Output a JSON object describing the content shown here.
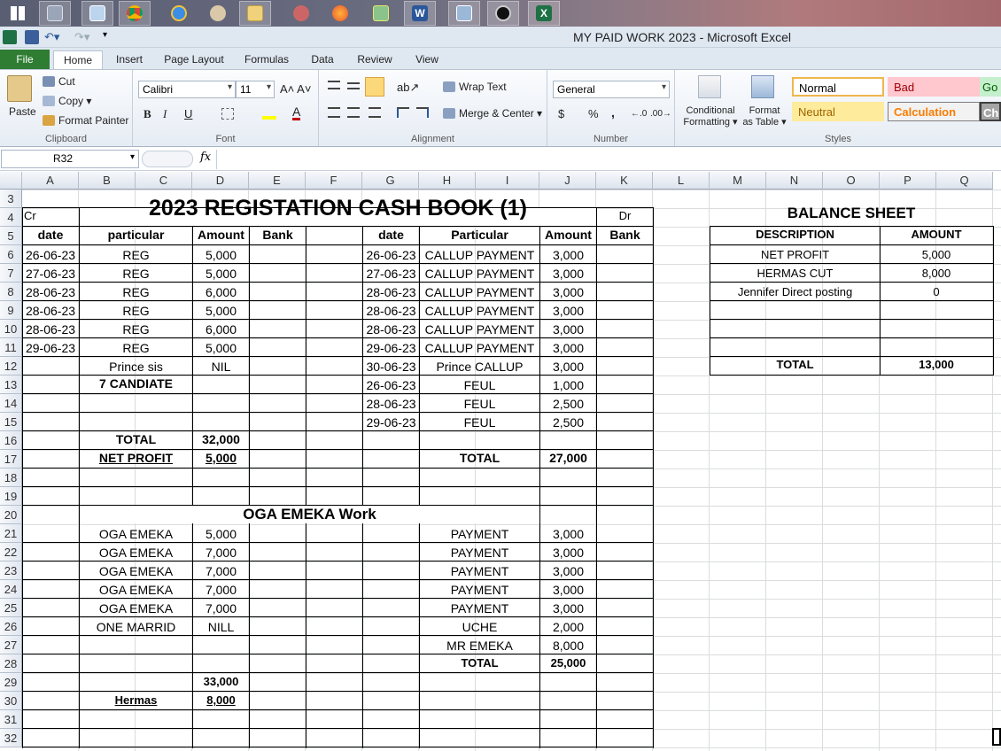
{
  "window": {
    "title": "MY PAID WORK 2023  -  Microsoft Excel"
  },
  "colors": {
    "accent": "#2e7d32",
    "ribbon_bg": "#e6ecf4",
    "style_bad": "#ffc7ce",
    "style_neutral": "#ffeb9c",
    "style_good": "#c6efce"
  },
  "taskbar": {
    "icons": [
      "start-icon",
      "calculator-icon",
      "notepad-icon",
      "chrome-icon",
      "internet-explorer-icon",
      "paint-icon",
      "file-explorer-icon",
      "media-player-icon",
      "firefox-icon",
      "photo-viewer-icon",
      "word-icon",
      "image-viewer-icon",
      "app-icon",
      "excel-icon"
    ]
  },
  "tabs": [
    "File",
    "Home",
    "Insert",
    "Page Layout",
    "Formulas",
    "Data",
    "Review",
    "View"
  ],
  "ribbon": {
    "clipboard": {
      "label": "Clipboard",
      "paste": "Paste",
      "cut": "Cut",
      "copy": "Copy",
      "format_painter": "Format Painter"
    },
    "font": {
      "label": "Font",
      "name": "Calibri",
      "size": "11",
      "bold": "B",
      "italic": "I",
      "underline": "U"
    },
    "alignment": {
      "label": "Alignment",
      "wrap": "Wrap Text",
      "merge": "Merge & Center"
    },
    "number": {
      "label": "Number",
      "format": "General",
      "currency": "$",
      "percent": "%",
      "comma": ","
    },
    "styles": {
      "label": "Styles",
      "conditional_1": "Conditional",
      "conditional_2": "Formatting",
      "table_1": "Format",
      "table_2": "as Table",
      "normal": "Normal",
      "bad": "Bad",
      "good": "Go",
      "neutral": "Neutral",
      "calculation": "Calculation",
      "check": "Che"
    }
  },
  "formula_bar": {
    "name_box": "R32",
    "fx": "fx",
    "value": ""
  },
  "columns": [
    "A",
    "B",
    "C",
    "D",
    "E",
    "F",
    "G",
    "H",
    "I",
    "J",
    "K",
    "L",
    "M",
    "N",
    "O",
    "P",
    "Q"
  ],
  "rows": [
    "3",
    "4",
    "5",
    "6",
    "7",
    "8",
    "9",
    "10",
    "11",
    "12",
    "13",
    "14",
    "15",
    "16",
    "17",
    "18",
    "19",
    "20",
    "21",
    "22",
    "23",
    "24",
    "25",
    "26",
    "27",
    "28",
    "29",
    "30",
    "31",
    "32"
  ],
  "sheet": {
    "title": "2023  REGISTATION CASH BOOK (1)",
    "cr": "Cr",
    "dr": "Dr",
    "left_headers": {
      "date": "date",
      "particular": "particular",
      "amount": "Amount",
      "bank": "Bank"
    },
    "right_headers": {
      "date": "date",
      "particular": "Particular",
      "amount": "Amount",
      "bank": "Bank"
    },
    "left_rows": [
      {
        "date": "26-06-23",
        "particular": "REG",
        "amount": "5,000"
      },
      {
        "date": "27-06-23",
        "particular": "REG",
        "amount": "5,000"
      },
      {
        "date": "28-06-23",
        "particular": "REG",
        "amount": "6,000"
      },
      {
        "date": "28-06-23",
        "particular": "REG",
        "amount": "5,000"
      },
      {
        "date": "28-06-23",
        "particular": "REG",
        "amount": "6,000"
      },
      {
        "date": "29-06-23",
        "particular": "REG",
        "amount": "5,000"
      },
      {
        "date": "",
        "particular": "Prince sis",
        "amount": "NIL"
      }
    ],
    "candidates": "7 CANDIATE",
    "right_rows": [
      {
        "date": "26-06-23",
        "particular": "CALLUP PAYMENT",
        "amount": "3,000"
      },
      {
        "date": "27-06-23",
        "particular": "CALLUP PAYMENT",
        "amount": "3,000"
      },
      {
        "date": "28-06-23",
        "particular": "CALLUP PAYMENT",
        "amount": "3,000"
      },
      {
        "date": "28-06-23",
        "particular": "CALLUP PAYMENT",
        "amount": "3,000"
      },
      {
        "date": "28-06-23",
        "particular": "CALLUP PAYMENT",
        "amount": "3,000"
      },
      {
        "date": "29-06-23",
        "particular": "CALLUP PAYMENT",
        "amount": "3,000"
      },
      {
        "date": "30-06-23",
        "particular": "Prince  CALLUP",
        "amount": "3,000"
      },
      {
        "date": "26-06-23",
        "particular": "FEUL",
        "amount": "1,000"
      },
      {
        "date": "28-06-23",
        "particular": "FEUL",
        "amount": "2,500"
      },
      {
        "date": "29-06-23",
        "particular": "FEUL",
        "amount": "2,500"
      }
    ],
    "left_total_label": "TOTAL",
    "left_total": "32,000",
    "net_profit_label": "NET PROFIT",
    "net_profit": "5,000",
    "right_total_label": "TOTAL",
    "right_total": "27,000",
    "oga_title": "OGA EMEKA Work",
    "oga_left": [
      {
        "particular": "OGA EMEKA",
        "amount": "5,000"
      },
      {
        "particular": "OGA EMEKA",
        "amount": "7,000"
      },
      {
        "particular": "OGA EMEKA",
        "amount": "7,000"
      },
      {
        "particular": "OGA EMEKA",
        "amount": "7,000"
      },
      {
        "particular": "OGA EMEKA",
        "amount": "7,000"
      },
      {
        "particular": "ONE MARRID",
        "amount": "NILL"
      }
    ],
    "oga_right": [
      {
        "particular": "PAYMENT",
        "amount": "3,000"
      },
      {
        "particular": "PAYMENT",
        "amount": "3,000"
      },
      {
        "particular": "PAYMENT",
        "amount": "3,000"
      },
      {
        "particular": "PAYMENT",
        "amount": "3,000"
      },
      {
        "particular": "PAYMENT",
        "amount": "3,000"
      },
      {
        "particular": "UCHE",
        "amount": "2,000"
      },
      {
        "particular": "MR EMEKA",
        "amount": "8,000"
      }
    ],
    "oga_right_total_label": "TOTAL",
    "oga_right_total": "25,000",
    "oga_left_total": "33,000",
    "hermas_label": "Hermas",
    "hermas_value": "8,000",
    "balance": {
      "title": "BALANCE SHEET",
      "desc_header": "DESCRIPTION",
      "amount_header": "AMOUNT",
      "rows": [
        {
          "desc": "NET PROFIT",
          "amount": "5,000"
        },
        {
          "desc": "HERMAS CUT",
          "amount": "8,000"
        },
        {
          "desc": "Jennifer Direct posting",
          "amount": "0"
        }
      ],
      "total_label": "TOTAL",
      "total": "13,000"
    }
  }
}
